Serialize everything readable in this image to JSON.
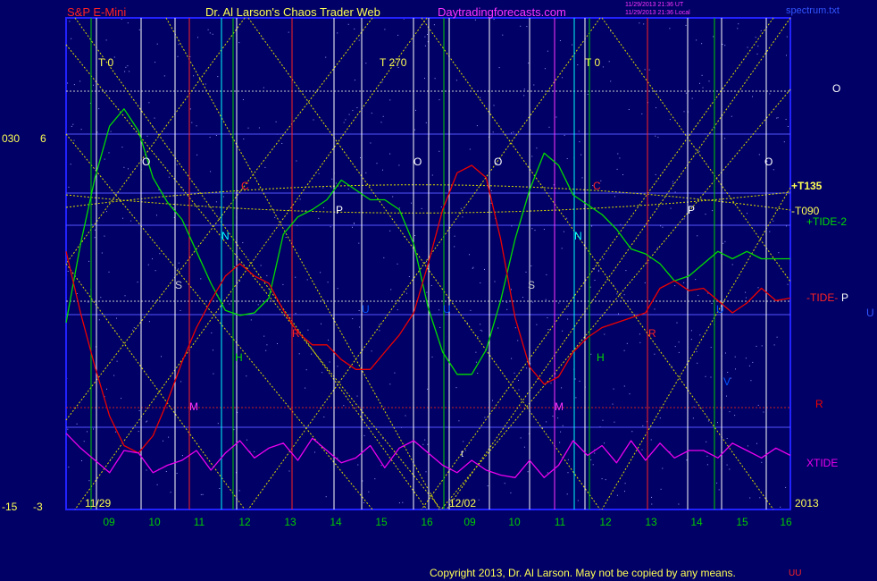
{
  "header": {
    "instrument": "S&P E-Mini",
    "title": "Dr. Al Larson's Chaos Trader Web",
    "site": "Daytradingforecasts.com",
    "timestamp_1": "11/29/2013 21:36 UT",
    "timestamp_2": "11/29/2013 21:36 Local",
    "file": "spectrum.txt"
  },
  "footer": {
    "copyright": "Copyright 2013, Dr. Al Larson. May not be copied by any means.",
    "mark": "UU"
  },
  "colors": {
    "background": "#000066",
    "plot_border": "#2222ff",
    "tide_green": "#00dd00",
    "tide_red": "#ee0000",
    "xtide_magenta": "#ee00ee",
    "timeline_white": "#ffffff",
    "timeline_cyan": "#00ffff",
    "timeline_red": "#ff2222",
    "timeline_green": "#00cc00",
    "timeline_magenta": "#ff33ff",
    "grid_yellow": "#dddd00"
  },
  "chart_data": {
    "type": "line",
    "title": "S&P E-Mini",
    "date_labels": [
      "11/29",
      "12/02",
      "2013"
    ],
    "x_hour_ticks": [
      "09",
      "10",
      "11",
      "12",
      "13",
      "14",
      "15",
      "16",
      "09",
      "10",
      "11",
      "12",
      "13",
      "14",
      "15",
      "16"
    ],
    "left_axis": {
      "labels_outer": [
        "030",
        "-15"
      ],
      "labels_inner": [
        "6",
        "-3"
      ]
    },
    "right_labels": {
      "o_marker": "O",
      "t135": "+T135",
      "t090": "-T090",
      "tide2": "+TIDE-2",
      "tide": "-TIDE-",
      "tide_p": "P",
      "u": "U",
      "r": "R",
      "xtide": "XTIDE"
    },
    "planet_markers": {
      "T0_a": "T 0",
      "T270": "T 270",
      "T0_b": "T 0",
      "O": "O",
      "S": "S",
      "N": "N",
      "H": "H",
      "M": "M",
      "C": "C",
      "R": "R",
      "P": "P",
      "U": "U",
      "V": "V",
      "t": "t"
    },
    "series": [
      {
        "name": "+TIDE-2",
        "color": "#00dd00",
        "x": [
          0,
          0.02,
          0.04,
          0.06,
          0.08,
          0.1,
          0.12,
          0.14,
          0.16,
          0.18,
          0.2,
          0.22,
          0.24,
          0.26,
          0.28,
          0.3,
          0.32,
          0.34,
          0.36,
          0.38,
          0.4,
          0.42,
          0.44,
          0.46,
          0.48,
          0.5,
          0.52,
          0.54,
          0.56,
          0.58,
          0.6,
          0.62,
          0.64,
          0.66,
          0.68,
          0.7,
          0.72,
          0.74,
          0.76,
          0.78,
          0.8,
          0.82,
          0.84,
          0.86,
          0.88,
          0.9,
          0.92,
          0.94,
          0.96,
          0.98,
          1.0
        ],
        "y": [
          -2.4,
          0.8,
          3.5,
          5.6,
          6.3,
          5.4,
          3.5,
          2.5,
          1.8,
          0.5,
          -0.8,
          -1.9,
          -2.1,
          -2.0,
          -1.4,
          1.2,
          1.9,
          2.2,
          2.6,
          3.4,
          3.0,
          2.6,
          2.6,
          2.2,
          0.8,
          -1.8,
          -3.6,
          -4.5,
          -4.5,
          -3.5,
          -1.5,
          1.0,
          3.0,
          4.5,
          4.0,
          2.8,
          2.4,
          2.0,
          1.4,
          0.6,
          0.4,
          0.0,
          -0.7,
          -0.5,
          0.0,
          0.5,
          0.2,
          0.5,
          0.2,
          0.2,
          0.2
        ]
      },
      {
        "name": "-TIDE-",
        "color": "#ee0000",
        "x": [
          0,
          0.02,
          0.04,
          0.06,
          0.08,
          0.1,
          0.12,
          0.14,
          0.16,
          0.18,
          0.2,
          0.22,
          0.24,
          0.26,
          0.28,
          0.3,
          0.32,
          0.34,
          0.36,
          0.38,
          0.4,
          0.42,
          0.44,
          0.46,
          0.48,
          0.5,
          0.52,
          0.54,
          0.56,
          0.58,
          0.6,
          0.62,
          0.64,
          0.66,
          0.68,
          0.7,
          0.72,
          0.74,
          0.76,
          0.78,
          0.8,
          0.82,
          0.84,
          0.86,
          0.88,
          0.9,
          0.92,
          0.94,
          0.96,
          0.98,
          1.0
        ],
        "y": [
          0.5,
          -2.0,
          -4.2,
          -6.2,
          -7.4,
          -7.7,
          -7.0,
          -5.6,
          -4.0,
          -2.6,
          -1.5,
          -0.5,
          0.0,
          -0.5,
          -0.8,
          -1.9,
          -2.8,
          -3.3,
          -3.3,
          -3.9,
          -4.3,
          -4.3,
          -3.6,
          -2.9,
          -2.0,
          0.0,
          2.2,
          3.7,
          4.0,
          3.5,
          1.0,
          -2.2,
          -4.2,
          -4.9,
          -4.6,
          -3.6,
          -3.0,
          -2.6,
          -2.4,
          -2.2,
          -2.0,
          -1.0,
          -0.7,
          -1.1,
          -1.0,
          -1.5,
          -2.0,
          -1.6,
          -1.0,
          -1.5,
          -1.4
        ]
      },
      {
        "name": "XTIDE",
        "color": "#ee00ee",
        "x": [
          0,
          0.02,
          0.04,
          0.06,
          0.08,
          0.1,
          0.12,
          0.14,
          0.16,
          0.18,
          0.2,
          0.22,
          0.24,
          0.26,
          0.28,
          0.3,
          0.32,
          0.34,
          0.36,
          0.38,
          0.4,
          0.42,
          0.44,
          0.46,
          0.48,
          0.5,
          0.52,
          0.54,
          0.56,
          0.58,
          0.6,
          0.62,
          0.64,
          0.66,
          0.68,
          0.7,
          0.72,
          0.74,
          0.76,
          0.78,
          0.8,
          0.82,
          0.84,
          0.86,
          0.88,
          0.9,
          0.92,
          0.94,
          0.96,
          0.98,
          1.0
        ],
        "y": [
          -6.9,
          -7.5,
          -8.0,
          -8.5,
          -7.6,
          -7.7,
          -8.5,
          -8.2,
          -8.0,
          -7.6,
          -8.4,
          -7.7,
          -7.2,
          -7.9,
          -7.5,
          -7.3,
          -8.0,
          -7.1,
          -7.6,
          -8.1,
          -7.9,
          -7.4,
          -8.3,
          -7.5,
          -7.2,
          -7.7,
          -8.2,
          -8.5,
          -8.0,
          -8.4,
          -8.6,
          -8.7,
          -8.0,
          -8.7,
          -8.2,
          -7.2,
          -7.8,
          -7.4,
          -8.1,
          -7.2,
          -8.0,
          -7.3,
          -7.9,
          -7.6,
          -7.6,
          -7.9,
          -7.3,
          -7.6,
          -7.9,
          -7.5,
          -7.8
        ]
      }
    ],
    "ylim": [
      -10,
      10
    ]
  }
}
